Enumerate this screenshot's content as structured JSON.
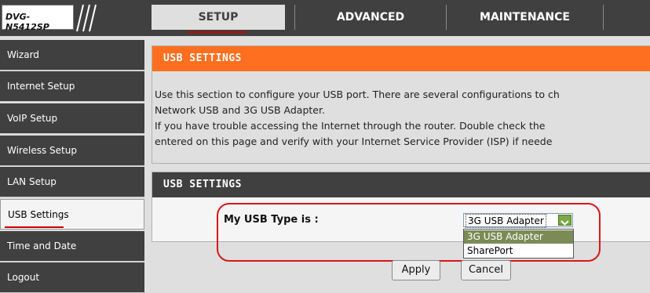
{
  "header": {
    "logo_text": "DVG-N5412SP",
    "tabs": [
      {
        "label": "SETUP",
        "active": true
      },
      {
        "label": "ADVANCED",
        "active": false
      },
      {
        "label": "MAINTENANCE",
        "active": false
      }
    ]
  },
  "sidebar": {
    "items": [
      {
        "label": "Wizard"
      },
      {
        "label": "Internet Setup"
      },
      {
        "label": "VoIP Setup"
      },
      {
        "label": "Wireless Setup"
      },
      {
        "label": "LAN Setup"
      },
      {
        "label": "USB Settings",
        "selected": true
      },
      {
        "label": "Time and Date"
      },
      {
        "label": "Logout"
      }
    ]
  },
  "info_box": {
    "title": "USB SETTINGS",
    "lines": [
      "Use this section to configure your USB port. There are several configurations to ch",
      "Network USB and 3G USB Adapter.",
      "If you have trouble accessing the Internet through the router. Double check the",
      "entered on this page and verify with your Internet Service Provider (ISP) if neede"
    ]
  },
  "settings_box": {
    "title": "USB SETTINGS",
    "usb_type_label": "My USB Type is :",
    "usb_type_selected": "3G USB Adapter",
    "usb_type_options": [
      "3G USB Adapter",
      "SharePort"
    ]
  },
  "buttons": {
    "apply": "Apply",
    "cancel": "Cancel"
  },
  "colors": {
    "accent_orange": "#ff6f1f",
    "dark_bar": "#404040",
    "annotation_red": "#d81818"
  },
  "icons": [
    "chevron-down-icon"
  ]
}
